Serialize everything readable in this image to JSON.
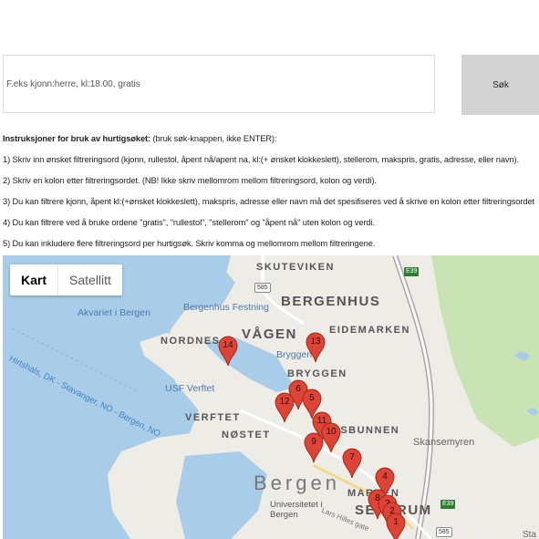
{
  "search": {
    "placeholder": "F.eks kjonn:herre, kl:18.00, gratis",
    "button_label": "Søk"
  },
  "instructions": {
    "heading": "Instruksjoner for bruk av hurtigsøket:",
    "heading_note": " (bruk søk-knappen, ikke ENTER):",
    "steps": [
      "1) Skriv inn ønsket filtreringsord (kjonn, rullestol, åpent nå/apent na, kl:(+ ønsket klokkeslett), stellerom, makspris, gratis, adresse, eller navn).",
      "2) Skriv en kolon etter filtreringsordet. (NB! Ikke skriv mellomrom mellom filtreringsord, kolon og verdi).",
      "3) Du kan filtrere kjonn, åpent kl:(+ønsket klokkeslett), makspris, adresse eller navn må det spesifiseres ved å skrive en kolon etter filtreringsordet",
      "4) Du kan filtrere ved å bruke ordene \"gratis\", \"rullestol\", \"stellerom\" og \"åpent nå\" uten kolon og verdi.",
      "5) Du kan inkludere flere filtreringsord per hurtigsøk. Skriv komma og mellomrom mellom filtreringene."
    ]
  },
  "map": {
    "type_buttons": [
      "Kart",
      "Satellitt"
    ],
    "active_type": "Kart",
    "labels": {
      "skuteviken": "SKUTEVIKEN",
      "bergenhus": "BERGENHUS",
      "vagen": "VÅGEN",
      "eidemarken": "EIDEMARKEN",
      "nordnes": "NORDNES",
      "bryggen_district": "BRYGGEN",
      "verftet": "VERFTET",
      "nostet": "NØSTET",
      "bunnen": "VÅGSBUNNEN",
      "bergen": "Bergen",
      "sentrum": "SENTRUM",
      "marken": "MARKEN",
      "skansemyren": "Skansemyren",
      "akvariet": "Akvariet i Bergen",
      "festning": "Bergenhus Festning",
      "bryggen_poi": "Bryggen",
      "usf": "USF Verftet",
      "universitetet": "Universitetet i Bergen",
      "lars_hilles": "Lars Hilles gate",
      "hurtigruten": "Hirtshals, DK - Stavanger, NO - Bergen, NO",
      "sta": "Sta",
      "r585a": "585",
      "r585b": "585",
      "e39a": "E39",
      "e39b": "E39"
    },
    "markers": [
      "14",
      "13",
      "6",
      "12",
      "5",
      "11",
      "10",
      "9",
      "7",
      "4",
      "8",
      "3",
      "2",
      "1"
    ]
  },
  "colors": {
    "water": "#a9cde8",
    "land": "#eeece6",
    "park": "#c9e3b5",
    "marker": "#db4437"
  }
}
